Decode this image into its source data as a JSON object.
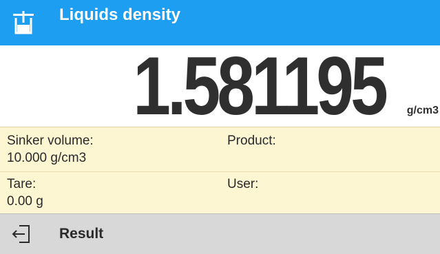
{
  "header": {
    "title": "Liquids density",
    "icon": "beaker-balance-icon",
    "color": "#1e9ef0"
  },
  "reading": {
    "value": "1.581195",
    "unit": "g/cm3"
  },
  "info": {
    "sinker_volume_label": "Sinker volume:",
    "sinker_volume_value": "10.000 g/cm3",
    "product_label": "Product:",
    "tare_label": "Tare:",
    "tare_value": "0.00 g",
    "user_label": "User:",
    "background": "#fdf6d3"
  },
  "footer": {
    "icon": "exit-icon",
    "label": "Result"
  }
}
